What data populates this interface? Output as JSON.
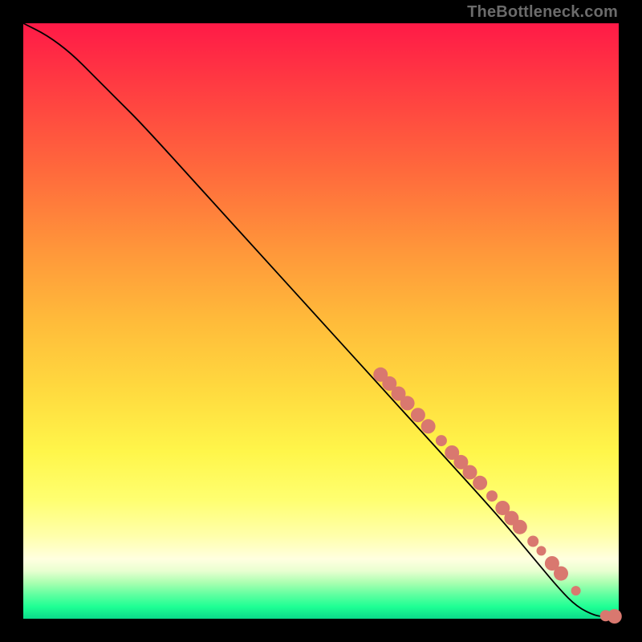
{
  "watermark": {
    "text": "TheBottleneck.com"
  },
  "colors": {
    "dot": "#d9786f",
    "line": "#000000",
    "frame": "#000000"
  },
  "chart_data": {
    "type": "line",
    "title": "",
    "xlabel": "",
    "ylabel": "",
    "xlim": [
      0,
      100
    ],
    "ylim": [
      0,
      100
    ],
    "grid": false,
    "legend": false,
    "series": [
      {
        "name": "curve",
        "kind": "line",
        "x": [
          0,
          4,
          8,
          12,
          16,
          20,
          30,
          40,
          50,
          60,
          70,
          80,
          85,
          90,
          93,
          96,
          98,
          100
        ],
        "y": [
          100,
          98,
          95,
          91,
          87,
          83,
          72,
          61,
          50,
          39,
          28,
          17,
          11,
          5,
          2,
          0.5,
          0.3,
          0.3
        ]
      },
      {
        "name": "dots",
        "kind": "scatter",
        "points": [
          {
            "x": 60.0,
            "y": 41.0,
            "size": "big"
          },
          {
            "x": 61.5,
            "y": 39.5,
            "size": "big"
          },
          {
            "x": 63.0,
            "y": 37.8,
            "size": "big"
          },
          {
            "x": 64.5,
            "y": 36.2,
            "size": "big"
          },
          {
            "x": 66.3,
            "y": 34.2,
            "size": "big"
          },
          {
            "x": 68.0,
            "y": 32.3,
            "size": "big"
          },
          {
            "x": 70.2,
            "y": 29.9,
            "size": "mid"
          },
          {
            "x": 72.0,
            "y": 27.9,
            "size": "big"
          },
          {
            "x": 73.5,
            "y": 26.3,
            "size": "big"
          },
          {
            "x": 75.0,
            "y": 24.6,
            "size": "big"
          },
          {
            "x": 76.7,
            "y": 22.8,
            "size": "big"
          },
          {
            "x": 78.7,
            "y": 20.6,
            "size": "mid"
          },
          {
            "x": 80.5,
            "y": 18.6,
            "size": "big"
          },
          {
            "x": 82.0,
            "y": 16.9,
            "size": "big"
          },
          {
            "x": 83.4,
            "y": 15.4,
            "size": "big"
          },
          {
            "x": 85.6,
            "y": 13.0,
            "size": "mid"
          },
          {
            "x": 87.0,
            "y": 11.4,
            "size": "sm"
          },
          {
            "x": 88.8,
            "y": 9.3,
            "size": "big"
          },
          {
            "x": 90.3,
            "y": 7.6,
            "size": "big"
          },
          {
            "x": 92.8,
            "y": 4.7,
            "size": "sm"
          },
          {
            "x": 97.8,
            "y": 0.5,
            "size": "mid"
          },
          {
            "x": 99.3,
            "y": 0.4,
            "size": "big"
          }
        ]
      }
    ]
  }
}
